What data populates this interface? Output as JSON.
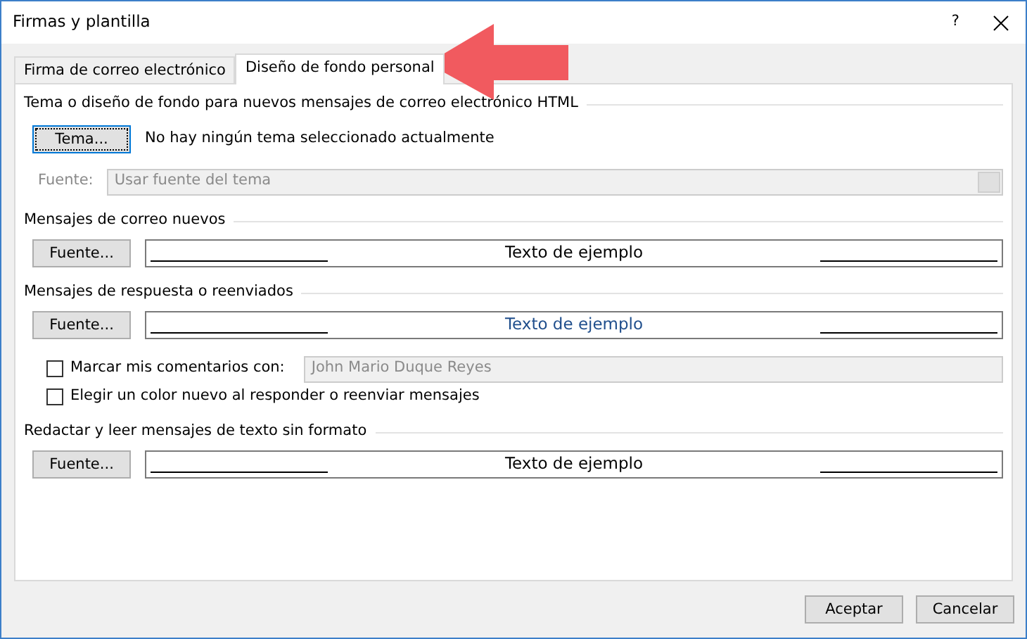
{
  "window": {
    "title": "Firmas y plantilla",
    "help": "?"
  },
  "tabs": [
    {
      "label": "Firma de correo electrónico",
      "selected": false
    },
    {
      "label": "Diseño de fondo personal",
      "selected": true
    }
  ],
  "theme": {
    "heading": "Tema o diseño de fondo para nuevos mensajes de correo electrónico HTML",
    "button": "Tema...",
    "status": "No hay ningún tema seleccionado actualmente",
    "font_label": "Fuente:",
    "font_select": {
      "value": "Usar fuente del tema",
      "disabled": true
    }
  },
  "items": [
    {
      "kind": "heading",
      "text": "Mensajes de correo nuevos"
    },
    {
      "kind": "font",
      "button": "Fuente...",
      "sample": "Texto de ejemplo",
      "color": "#000000"
    },
    {
      "kind": "heading",
      "text": "Mensajes de respuesta o reenviados"
    },
    {
      "kind": "font",
      "button": "Fuente...",
      "sample": "Texto de ejemplo",
      "color": "#1f4e8c"
    },
    {
      "kind": "checkbox",
      "label": "Marcar mis comentarios con:",
      "checked": false,
      "field": {
        "value": "John Mario Duque Reyes",
        "disabled": true
      }
    },
    {
      "kind": "checkbox",
      "label": "Elegir un color nuevo al responder o reenviar mensajes",
      "checked": false
    },
    {
      "kind": "heading",
      "text": "Redactar y leer mensajes de texto sin formato"
    },
    {
      "kind": "font",
      "button": "Fuente...",
      "sample": "Texto de ejemplo",
      "color": "#000000"
    }
  ],
  "buttons": [
    "Aceptar",
    "Cancelar"
  ]
}
